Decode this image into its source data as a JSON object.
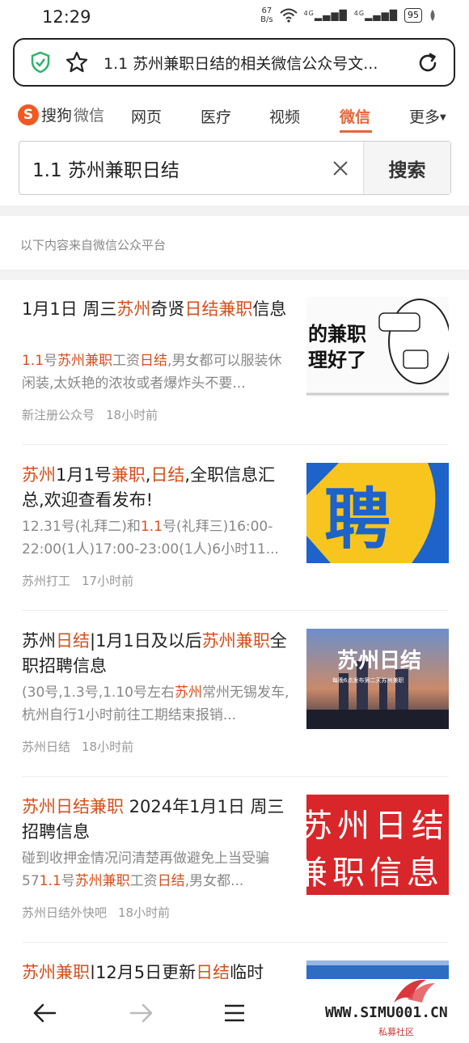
{
  "status_bar": {
    "time": "12:29",
    "net_speed_value": "67",
    "net_speed_unit": "B/s",
    "signal_1": "4G",
    "signal_2": "4G",
    "battery": "95"
  },
  "address_bar": {
    "url_text": "1.1 苏州兼职日结的相关微信公众号文..."
  },
  "nav": {
    "logo_text": "搜狗",
    "logo_sub": "微信",
    "tabs": [
      "网页",
      "医疗",
      "视频",
      "微信",
      "更多"
    ],
    "active_tab": "微信"
  },
  "search": {
    "query": "1.1 苏州兼职日结",
    "button_label": "搜索"
  },
  "source_note": "以下内容来自微信公众平台",
  "results": [
    {
      "title_parts": [
        [
          "1月1日 周三",
          false
        ],
        [
          "苏州",
          true
        ],
        [
          "奇贤",
          false
        ],
        [
          "日结兼职",
          true
        ],
        [
          "信息",
          false
        ]
      ],
      "summary_parts": [
        [
          "1.1",
          true
        ],
        [
          "号",
          false
        ],
        [
          "苏州兼职",
          true
        ],
        [
          "工资",
          false
        ],
        [
          "日结",
          true
        ],
        [
          ",男女都可以服装休闲装,太妖艳的浓妆或者爆炸头不要...",
          false
        ]
      ],
      "source": "新注册公众号",
      "time": "18小时前",
      "thumb_text": [
        "的兼职",
        "理好了"
      ]
    },
    {
      "title_parts": [
        [
          "苏州",
          true
        ],
        [
          "1月1号",
          false
        ],
        [
          "兼职",
          true
        ],
        [
          ",",
          false
        ],
        [
          "日结",
          true
        ],
        [
          ",全职信息汇总,欢迎查看发布!",
          false
        ]
      ],
      "summary_parts": [
        [
          "12.31号(礼拜二)和",
          false
        ],
        [
          "1.1",
          true
        ],
        [
          "号(礼拜三)16:00-22:00(1人)17:00-23:00(1人)6小时11...",
          false
        ]
      ],
      "source": "苏州打工",
      "time": "17小时前",
      "thumb_text": [
        "聘"
      ]
    },
    {
      "title_parts": [
        [
          "苏州",
          false
        ],
        [
          "日结",
          true
        ],
        [
          "|1月1日及以后",
          false
        ],
        [
          "苏州兼职",
          true
        ],
        [
          "全职招聘信息",
          false
        ]
      ],
      "summary_parts": [
        [
          "(30号,1.3号,1.10号左右",
          false
        ],
        [
          "苏州",
          true
        ],
        [
          "常州无锡发车,杭州自行1小时前往工期结束报销...",
          false
        ]
      ],
      "source": "苏州日结",
      "time": "18小时前",
      "thumb_text": [
        "苏州日结",
        "每晚6点发布第二天苏州兼职"
      ]
    },
    {
      "title_parts": [
        [
          "苏州日结兼职",
          true
        ],
        [
          " 2024年1月1日 周三 招聘信息",
          false
        ]
      ],
      "summary_parts": [
        [
          "碰到收押金情况问清楚再做避免上当受骗57",
          false
        ],
        [
          "1.1",
          true
        ],
        [
          "号",
          false
        ],
        [
          "苏州兼职",
          true
        ],
        [
          "工资",
          false
        ],
        [
          "日结",
          true
        ],
        [
          ",男女都...",
          false
        ]
      ],
      "source": "苏州日结外快吧",
      "time": "18小时前",
      "thumb_text": [
        "苏州日结",
        "兼职信息"
      ]
    }
  ],
  "partial_result": {
    "title_parts": [
      [
        "苏州兼职",
        true
      ],
      [
        "|12月5日更新",
        false
      ],
      [
        "日结",
        true
      ],
      [
        "临时",
        false
      ]
    ]
  },
  "watermark": {
    "text": "WWW.SIMU001.CN",
    "sub": "私募社区"
  },
  "colors": {
    "highlight": "#d64f1c",
    "active_tab": "#e4663a",
    "shield": "#2fb36a"
  }
}
